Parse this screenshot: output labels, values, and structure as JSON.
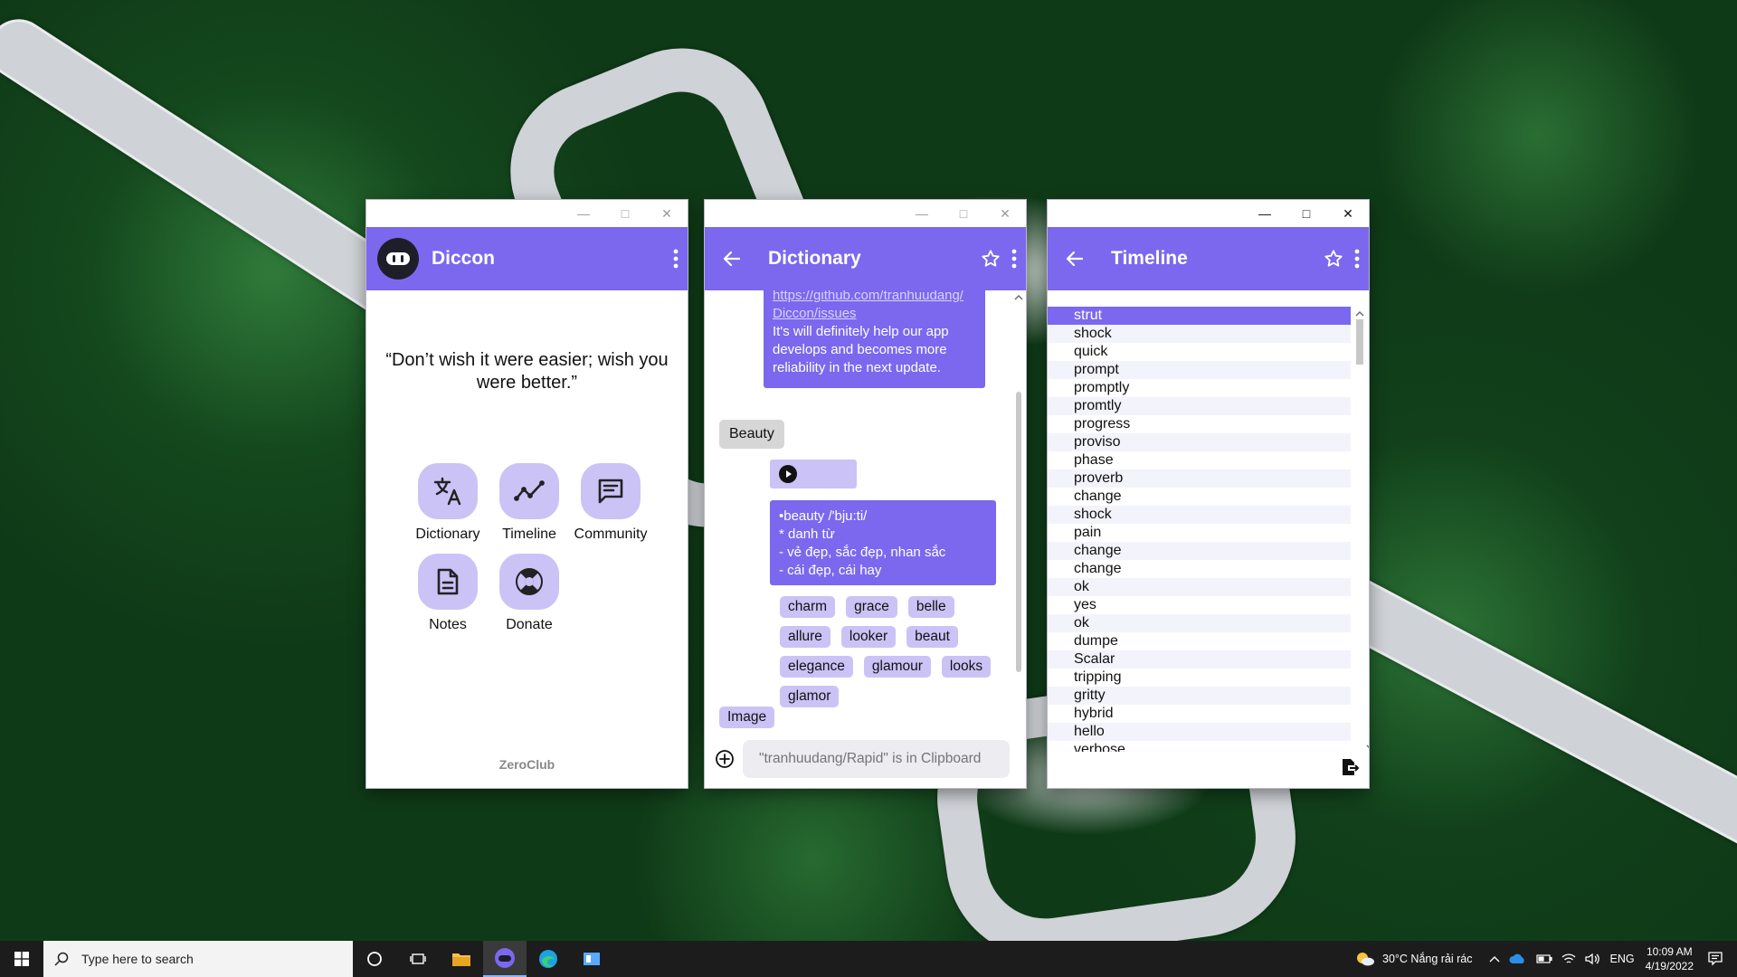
{
  "windows": {
    "home": {
      "app_name": "Diccon",
      "quote": "“Don’t wish it were easier; wish you were better.”",
      "tiles": [
        {
          "label": "Dictionary",
          "icon": "translate-icon"
        },
        {
          "label": "Timeline",
          "icon": "timeline-icon"
        },
        {
          "label": "Community",
          "icon": "chat-icon"
        },
        {
          "label": "Notes",
          "icon": "note-icon"
        },
        {
          "label": "Donate",
          "icon": "lifebuoy-icon"
        }
      ],
      "footer": "ZeroClub"
    },
    "dictionary": {
      "title": "Dictionary",
      "bot_message": {
        "link": "https://github.com/tranhuudang/Diccon/issues",
        "link_line1": "https://github.com/tranhuudang/",
        "link_line2": "Diccon/issues",
        "text": "It's will definitely help our app develops and becomes more reliability in the next update."
      },
      "user_query": "Beauty",
      "definition": {
        "line1": "•beauty /'bju:ti/",
        "line2": "*  danh từ",
        "line3": "- vẻ đẹp, sắc đẹp, nhan sắc",
        "line4": "- cái đẹp, cái hay"
      },
      "synonyms": [
        "charm",
        "grace",
        "belle",
        "allure",
        "looker",
        "beaut",
        "elegance",
        "glamour",
        "looks",
        "glamor"
      ],
      "image_label": "Image",
      "input_placeholder": "\"tranhuudang/Rapid\" is in Clipboard"
    },
    "timeline": {
      "title": "Timeline",
      "items": [
        "strut",
        "shock",
        "quick",
        "prompt",
        "promptly",
        "promtly",
        "progress",
        "proviso",
        "phase",
        "proverb",
        "change",
        "shock",
        "pain",
        "change",
        "change",
        "ok",
        "yes",
        "ok",
        "dumpe",
        "Scalar",
        "tripping",
        "gritty",
        "hybrid",
        "hello",
        "verbose"
      ],
      "selected_index": 0
    }
  },
  "taskbar": {
    "search_placeholder": "Type here to search",
    "weather": "30°C  Nắng rải rác",
    "language": "ENG",
    "time": "10:09 AM",
    "date": "4/19/2022"
  },
  "colors": {
    "accent": "#7b68ee",
    "accent_light": "#cbc3f6",
    "taskbar": "#1c1c1c"
  }
}
